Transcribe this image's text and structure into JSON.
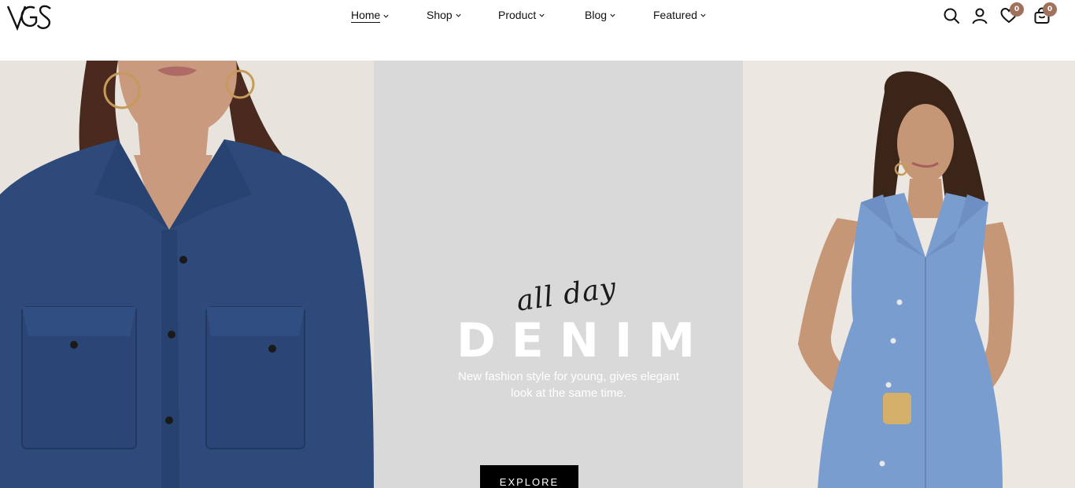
{
  "brand": {
    "logo_text": "VGS"
  },
  "nav": {
    "items": [
      {
        "label": "Home",
        "active": true
      },
      {
        "label": "Shop"
      },
      {
        "label": "Product"
      },
      {
        "label": "Blog"
      },
      {
        "label": "Featured"
      }
    ]
  },
  "header_icons": {
    "search": "search-icon",
    "account": "user-icon",
    "wishlist": "heart-icon",
    "wishlist_count": "0",
    "cart": "shopping-bag-icon",
    "cart_count": "0"
  },
  "hero": {
    "script_text": "all day",
    "headline": "DENIM",
    "subtitle": "New fashion style for young, gives elegant look at the same time.",
    "cta_label": "EXPLORE"
  },
  "colors": {
    "badge": "#a0715d",
    "center_panel": "#d9d9d9",
    "button": "#000000",
    "denim_dark": "#2e4a7a",
    "denim_light": "#7a9dd0"
  }
}
